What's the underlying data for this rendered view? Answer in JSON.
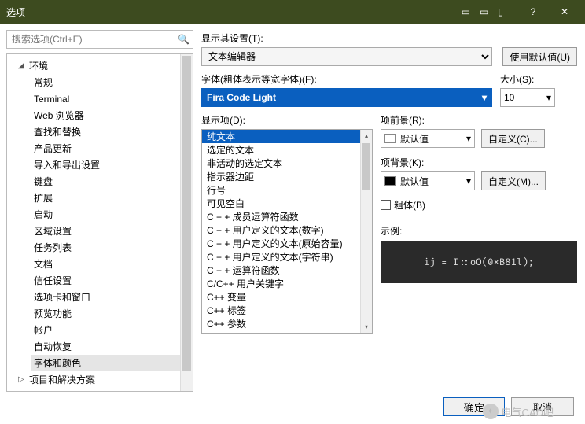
{
  "title": "选项",
  "search": {
    "placeholder": "搜索选项(Ctrl+E)"
  },
  "tree": {
    "root": "环境",
    "items": [
      "常规",
      "Terminal",
      "Web 浏览器",
      "查找和替换",
      "产品更新",
      "导入和导出设置",
      "键盘",
      "扩展",
      "启动",
      "区域设置",
      "任务列表",
      "文档",
      "信任设置",
      "选项卡和窗口",
      "预览功能",
      "帐户",
      "自动恢复",
      "字体和颜色"
    ],
    "next": "项目和解决方案"
  },
  "showSettings": {
    "label": "显示其设置(T):",
    "value": "文本编辑器",
    "defaultsBtn": "使用默认值(U)"
  },
  "font": {
    "label": "字体(粗体表示等宽字体)(F):",
    "value": "Fira Code Light"
  },
  "size": {
    "label": "大小(S):",
    "value": "10"
  },
  "display": {
    "label": "显示项(D):",
    "items": [
      "纯文本",
      "选定的文本",
      "非活动的选定文本",
      "指示器边距",
      "行号",
      "可见空白",
      "C + + 成员运算符函数",
      "C + + 用户定义的文本(数字)",
      "C + + 用户定义的文本(原始容量)",
      "C + + 用户定义的文本(字符串)",
      "C + + 运算符函数",
      "C/C++ 用户关键字",
      "C++ 变量",
      "C++ 标签",
      "C++ 参数"
    ]
  },
  "fg": {
    "label": "项前景(R):",
    "value": "默认值",
    "btn": "自定义(C)..."
  },
  "bg": {
    "label": "项背景(K):",
    "value": "默认值",
    "btn": "自定义(M)..."
  },
  "bold": {
    "label": "粗体(B)"
  },
  "sample": {
    "label": "示例:",
    "code": "ij = I::oO(0xB81l);"
  },
  "footer": {
    "ok": "确定",
    "cancel": "取消"
  },
  "watermark": "电气CAD吧"
}
